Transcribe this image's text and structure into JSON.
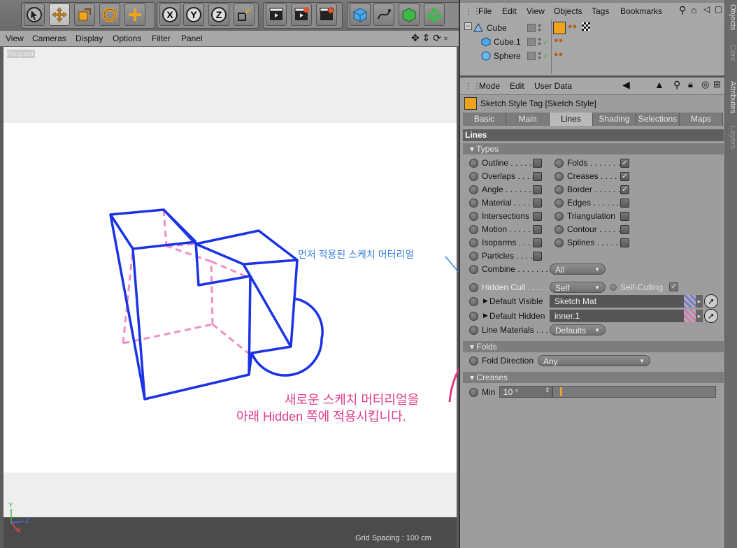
{
  "viewport_menu": [
    "View",
    "Cameras",
    "Display",
    "Options",
    "Filter",
    "Panel"
  ],
  "viewport_label": "Perspective",
  "grid_spacing": "Grid Spacing : 100 cm",
  "axis": {
    "y": "Y",
    "z": "Z",
    "x": "X"
  },
  "object_menu": [
    "File",
    "Edit",
    "View",
    "Objects",
    "Tags",
    "Bookmarks"
  ],
  "objects": [
    {
      "name": "Cube",
      "icon": "null-icon"
    },
    {
      "name": "Cube.1",
      "icon": "cube-icon"
    },
    {
      "name": "Sphere",
      "icon": "sphere-icon"
    }
  ],
  "attr_menu": [
    "Mode",
    "Edit",
    "User Data"
  ],
  "tag_title": "Sketch Style Tag [Sketch Style]",
  "tabs": [
    {
      "label": "Basic",
      "active": false
    },
    {
      "label": "Main",
      "active": false
    },
    {
      "label": "Lines",
      "active": true
    },
    {
      "label": "Shading",
      "active": false
    },
    {
      "label": "Selections",
      "active": false
    },
    {
      "label": "Maps",
      "active": false
    }
  ],
  "section_lines": "Lines",
  "section_types": "▾ Types",
  "types_left": [
    {
      "label": "Outline . . . . .",
      "checked": false
    },
    {
      "label": "Overlaps . . . .",
      "checked": false
    },
    {
      "label": "Angle . . . . . .",
      "checked": false
    },
    {
      "label": "Material . . . .",
      "checked": false
    },
    {
      "label": "Intersections",
      "checked": false
    },
    {
      "label": "Motion . . . . .",
      "checked": false
    },
    {
      "label": "Isoparms . . .",
      "checked": false
    },
    {
      "label": "Particles . . . .",
      "checked": false
    }
  ],
  "types_right": [
    {
      "label": "Folds . . . . . . .",
      "checked": true
    },
    {
      "label": "Creases . . . . .",
      "checked": true
    },
    {
      "label": "Border . . . . . .",
      "checked": true
    },
    {
      "label": "Edges . . . . . .",
      "checked": false
    },
    {
      "label": "Triangulation",
      "checked": false
    },
    {
      "label": "Contour . . . . .",
      "checked": false
    },
    {
      "label": "Splines . . . . . .",
      "checked": false
    }
  ],
  "combine": {
    "label": "Combine . . . . . . . .",
    "value": "All"
  },
  "hidden_cull": {
    "label": "Hidden Cull . . . . .",
    "value": "Self",
    "self_culling": "Self-Culling"
  },
  "default_visible": {
    "label": "Default Visible",
    "value": "Sketch Mat"
  },
  "default_hidden": {
    "label": "Default Hidden",
    "value": "inner.1"
  },
  "line_materials": {
    "label": "Line Materials . . .",
    "value": "Defaults"
  },
  "section_folds": "▾ Folds",
  "fold_direction": {
    "label": "Fold Direction",
    "value": "Any"
  },
  "section_creases": "▾ Creases",
  "creases_min": {
    "label": "Min",
    "value": "10 °"
  },
  "side_tabs": [
    "Objects",
    "Cont",
    "Attributes",
    "Layers"
  ],
  "annotation_blue": "먼저 적용된 스케치 머터리얼",
  "annotation_pink_1": "새로운 스케치 머터리얼을",
  "annotation_pink_2": "아래 Hidden 쪽에 적용시킵니다.",
  "colors": {
    "sketch_line": "#1a33e6",
    "hidden_line": "#f08fc8",
    "annot_blue": "#3a80d8",
    "annot_pink": "#e03c8a"
  }
}
